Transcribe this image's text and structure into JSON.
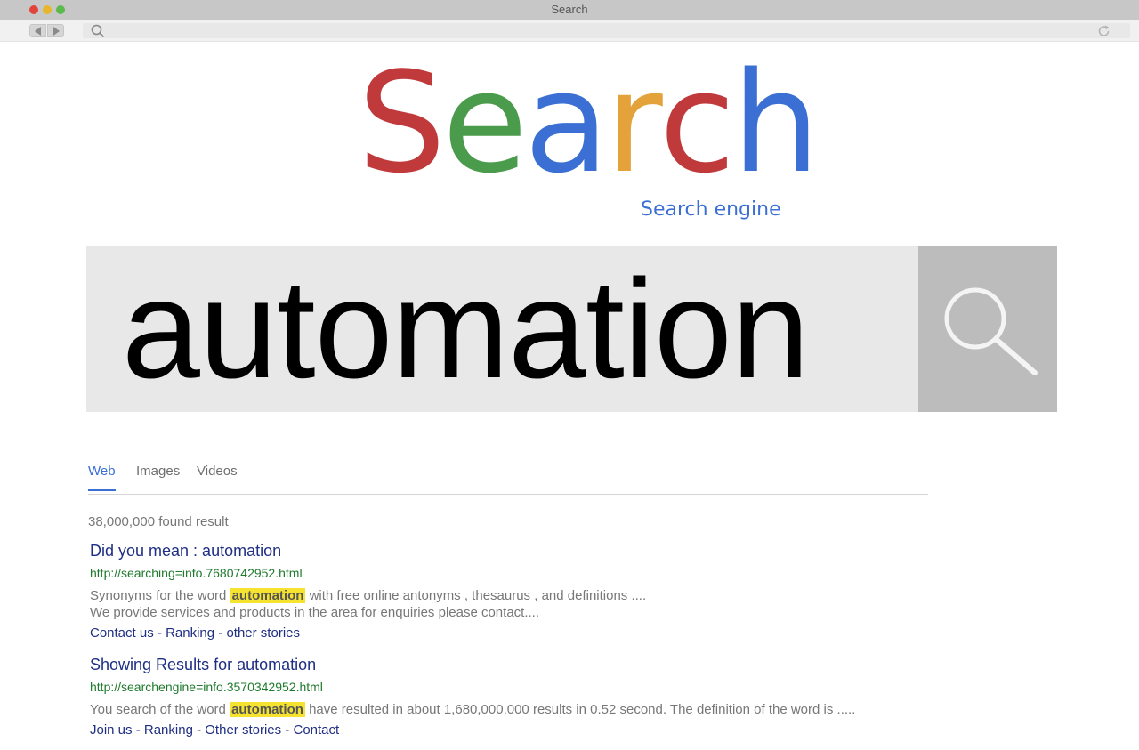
{
  "window": {
    "title": "Search"
  },
  "logo": {
    "letters": [
      {
        "char": "S",
        "color": "#c0393b"
      },
      {
        "char": "e",
        "color": "#4a9b4c"
      },
      {
        "char": "a",
        "color": "#3b6fd4"
      },
      {
        "char": "r",
        "color": "#e3a33a"
      },
      {
        "char": "c",
        "color": "#c0393b"
      },
      {
        "char": "h",
        "color": "#3b6fd4"
      }
    ],
    "subtitle": "Search engine"
  },
  "search": {
    "query": "automation"
  },
  "tabs": [
    {
      "label": "Web",
      "active": true
    },
    {
      "label": "Images",
      "active": false
    },
    {
      "label": "Videos",
      "active": false
    }
  ],
  "results_count": "38,000,000 found result",
  "results": [
    {
      "title": "Did you mean : automation",
      "url": "http://searching=info.7680742952.html",
      "snippet_line1_before": "Synonyms for the word",
      "snippet_line1_highlight": "automation",
      "snippet_line1_after": "with free online antonyms , thesaurus , and definitions ....",
      "snippet_line2": "We provide services and products in the area for enquiries please contact....",
      "links": [
        "Contact us",
        "Ranking",
        "other stories"
      ]
    },
    {
      "title": "Showing Results for automation",
      "url": "http://searchengine=info.3570342952.html",
      "snippet_line1_before": "You search of the word",
      "snippet_line1_highlight": "automation",
      "snippet_line1_after": "have resulted in about 1,680,000,000 results in 0.52 second. The definition of the word is .....",
      "snippet_line2": "",
      "links": [
        "Join us",
        "Ranking",
        "Other stories",
        "Contact"
      ]
    }
  ],
  "link_separator": " - ",
  "colors": {
    "accent_blue": "#3b6fd4",
    "title_navy": "#1f2f83",
    "url_green": "#1f7a2d",
    "highlight_yellow": "#f5e32f"
  },
  "icons": {
    "search_button": "magnifier-icon",
    "address_search": "search-icon",
    "reload": "reload-icon",
    "back": "back-arrow-icon",
    "forward": "forward-arrow-icon"
  }
}
